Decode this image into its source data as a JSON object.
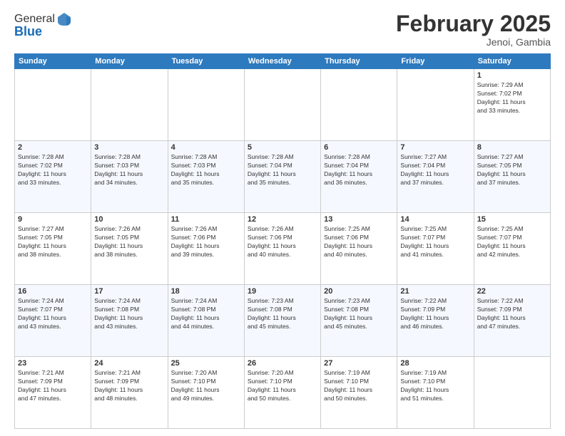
{
  "header": {
    "logo_line1": "General",
    "logo_line2": "Blue",
    "month_title": "February 2025",
    "location": "Jenoi, Gambia"
  },
  "days_of_week": [
    "Sunday",
    "Monday",
    "Tuesday",
    "Wednesday",
    "Thursday",
    "Friday",
    "Saturday"
  ],
  "weeks": [
    [
      {
        "day": "",
        "info": ""
      },
      {
        "day": "",
        "info": ""
      },
      {
        "day": "",
        "info": ""
      },
      {
        "day": "",
        "info": ""
      },
      {
        "day": "",
        "info": ""
      },
      {
        "day": "",
        "info": ""
      },
      {
        "day": "1",
        "info": "Sunrise: 7:29 AM\nSunset: 7:02 PM\nDaylight: 11 hours\nand 33 minutes."
      }
    ],
    [
      {
        "day": "2",
        "info": "Sunrise: 7:28 AM\nSunset: 7:02 PM\nDaylight: 11 hours\nand 33 minutes."
      },
      {
        "day": "3",
        "info": "Sunrise: 7:28 AM\nSunset: 7:03 PM\nDaylight: 11 hours\nand 34 minutes."
      },
      {
        "day": "4",
        "info": "Sunrise: 7:28 AM\nSunset: 7:03 PM\nDaylight: 11 hours\nand 35 minutes."
      },
      {
        "day": "5",
        "info": "Sunrise: 7:28 AM\nSunset: 7:04 PM\nDaylight: 11 hours\nand 35 minutes."
      },
      {
        "day": "6",
        "info": "Sunrise: 7:28 AM\nSunset: 7:04 PM\nDaylight: 11 hours\nand 36 minutes."
      },
      {
        "day": "7",
        "info": "Sunrise: 7:27 AM\nSunset: 7:04 PM\nDaylight: 11 hours\nand 37 minutes."
      },
      {
        "day": "8",
        "info": "Sunrise: 7:27 AM\nSunset: 7:05 PM\nDaylight: 11 hours\nand 37 minutes."
      }
    ],
    [
      {
        "day": "9",
        "info": "Sunrise: 7:27 AM\nSunset: 7:05 PM\nDaylight: 11 hours\nand 38 minutes."
      },
      {
        "day": "10",
        "info": "Sunrise: 7:26 AM\nSunset: 7:05 PM\nDaylight: 11 hours\nand 38 minutes."
      },
      {
        "day": "11",
        "info": "Sunrise: 7:26 AM\nSunset: 7:06 PM\nDaylight: 11 hours\nand 39 minutes."
      },
      {
        "day": "12",
        "info": "Sunrise: 7:26 AM\nSunset: 7:06 PM\nDaylight: 11 hours\nand 40 minutes."
      },
      {
        "day": "13",
        "info": "Sunrise: 7:25 AM\nSunset: 7:06 PM\nDaylight: 11 hours\nand 40 minutes."
      },
      {
        "day": "14",
        "info": "Sunrise: 7:25 AM\nSunset: 7:07 PM\nDaylight: 11 hours\nand 41 minutes."
      },
      {
        "day": "15",
        "info": "Sunrise: 7:25 AM\nSunset: 7:07 PM\nDaylight: 11 hours\nand 42 minutes."
      }
    ],
    [
      {
        "day": "16",
        "info": "Sunrise: 7:24 AM\nSunset: 7:07 PM\nDaylight: 11 hours\nand 43 minutes."
      },
      {
        "day": "17",
        "info": "Sunrise: 7:24 AM\nSunset: 7:08 PM\nDaylight: 11 hours\nand 43 minutes."
      },
      {
        "day": "18",
        "info": "Sunrise: 7:24 AM\nSunset: 7:08 PM\nDaylight: 11 hours\nand 44 minutes."
      },
      {
        "day": "19",
        "info": "Sunrise: 7:23 AM\nSunset: 7:08 PM\nDaylight: 11 hours\nand 45 minutes."
      },
      {
        "day": "20",
        "info": "Sunrise: 7:23 AM\nSunset: 7:08 PM\nDaylight: 11 hours\nand 45 minutes."
      },
      {
        "day": "21",
        "info": "Sunrise: 7:22 AM\nSunset: 7:09 PM\nDaylight: 11 hours\nand 46 minutes."
      },
      {
        "day": "22",
        "info": "Sunrise: 7:22 AM\nSunset: 7:09 PM\nDaylight: 11 hours\nand 47 minutes."
      }
    ],
    [
      {
        "day": "23",
        "info": "Sunrise: 7:21 AM\nSunset: 7:09 PM\nDaylight: 11 hours\nand 47 minutes."
      },
      {
        "day": "24",
        "info": "Sunrise: 7:21 AM\nSunset: 7:09 PM\nDaylight: 11 hours\nand 48 minutes."
      },
      {
        "day": "25",
        "info": "Sunrise: 7:20 AM\nSunset: 7:10 PM\nDaylight: 11 hours\nand 49 minutes."
      },
      {
        "day": "26",
        "info": "Sunrise: 7:20 AM\nSunset: 7:10 PM\nDaylight: 11 hours\nand 50 minutes."
      },
      {
        "day": "27",
        "info": "Sunrise: 7:19 AM\nSunset: 7:10 PM\nDaylight: 11 hours\nand 50 minutes."
      },
      {
        "day": "28",
        "info": "Sunrise: 7:19 AM\nSunset: 7:10 PM\nDaylight: 11 hours\nand 51 minutes."
      },
      {
        "day": "",
        "info": ""
      }
    ]
  ]
}
